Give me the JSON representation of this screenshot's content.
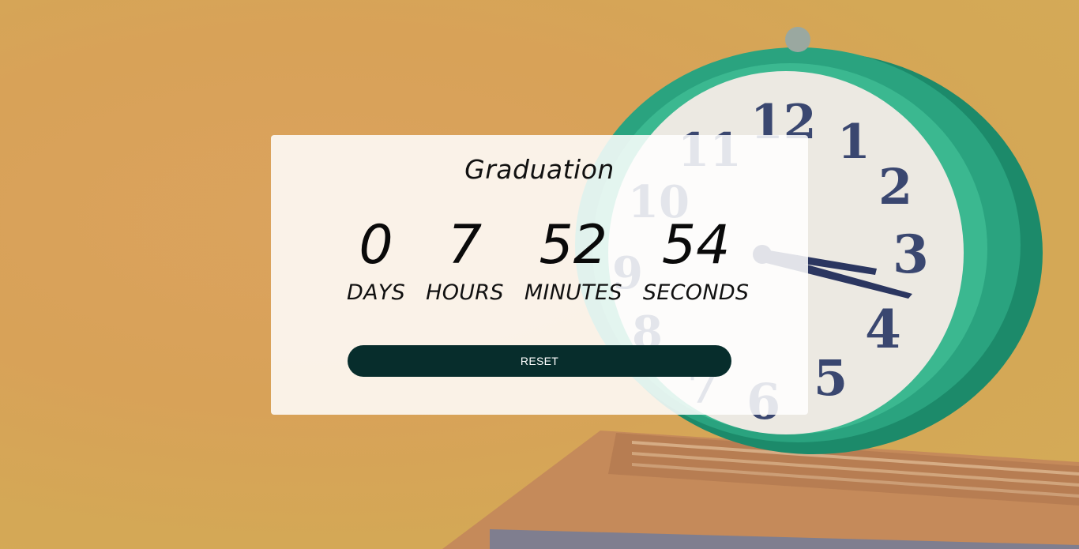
{
  "event": {
    "title": "Graduation"
  },
  "countdown": [
    {
      "value": "0",
      "label": "DAYS"
    },
    {
      "value": "7",
      "label": "HOURS"
    },
    {
      "value": "52",
      "label": "MINUTES"
    },
    {
      "value": "54",
      "label": "SECONDS"
    }
  ],
  "actions": {
    "reset_label": "RESET"
  },
  "colors": {
    "background": "#dba35e",
    "button": "#072d2c",
    "button_text": "#ffffff",
    "card": "#fdf8f2",
    "clock_case": "#2aa37f"
  },
  "background_image": {
    "clock_numerals": [
      "12",
      "1",
      "2",
      "3",
      "4",
      "5",
      "6",
      "7",
      "8",
      "9",
      "10",
      "11"
    ]
  }
}
